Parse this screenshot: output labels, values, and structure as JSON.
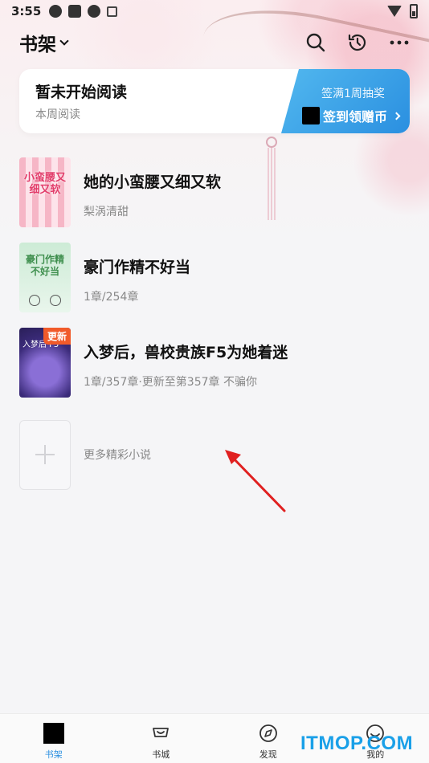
{
  "status_bar": {
    "time": "3:55"
  },
  "header": {
    "title": "书架"
  },
  "reading_card": {
    "title": "暂未开始阅读",
    "subtitle": "本周阅读",
    "promo_top": "签满1周抽奖",
    "promo_button": "签到领赠币"
  },
  "books": [
    {
      "title": "她的小蛮腰又细又软",
      "meta": "梨涡清甜",
      "cover_text": "小蛮腰又细又软"
    },
    {
      "title": "豪门作精不好当",
      "meta": "1章/254章",
      "cover_text": "豪门作精不好当"
    },
    {
      "title": "入梦后，兽校贵族F5为她着迷",
      "meta": "1章/357章·更新至第357章 不骗你",
      "cover_text": "入梦后 F5",
      "badge": "更新"
    }
  ],
  "add_more": {
    "label": "更多精彩小说"
  },
  "bottom_nav": [
    {
      "label": "书架",
      "icon": "bookshelf-icon",
      "active": true
    },
    {
      "label": "书城",
      "icon": "store-icon",
      "active": false
    },
    {
      "label": "发现",
      "icon": "compass-icon",
      "active": false
    },
    {
      "label": "我的",
      "icon": "profile-icon",
      "active": false
    }
  ],
  "watermark": "ITMOP.COM",
  "colors": {
    "accent": "#2a8fe0",
    "badge": "#f15a2a",
    "annotation": "#e02020"
  }
}
